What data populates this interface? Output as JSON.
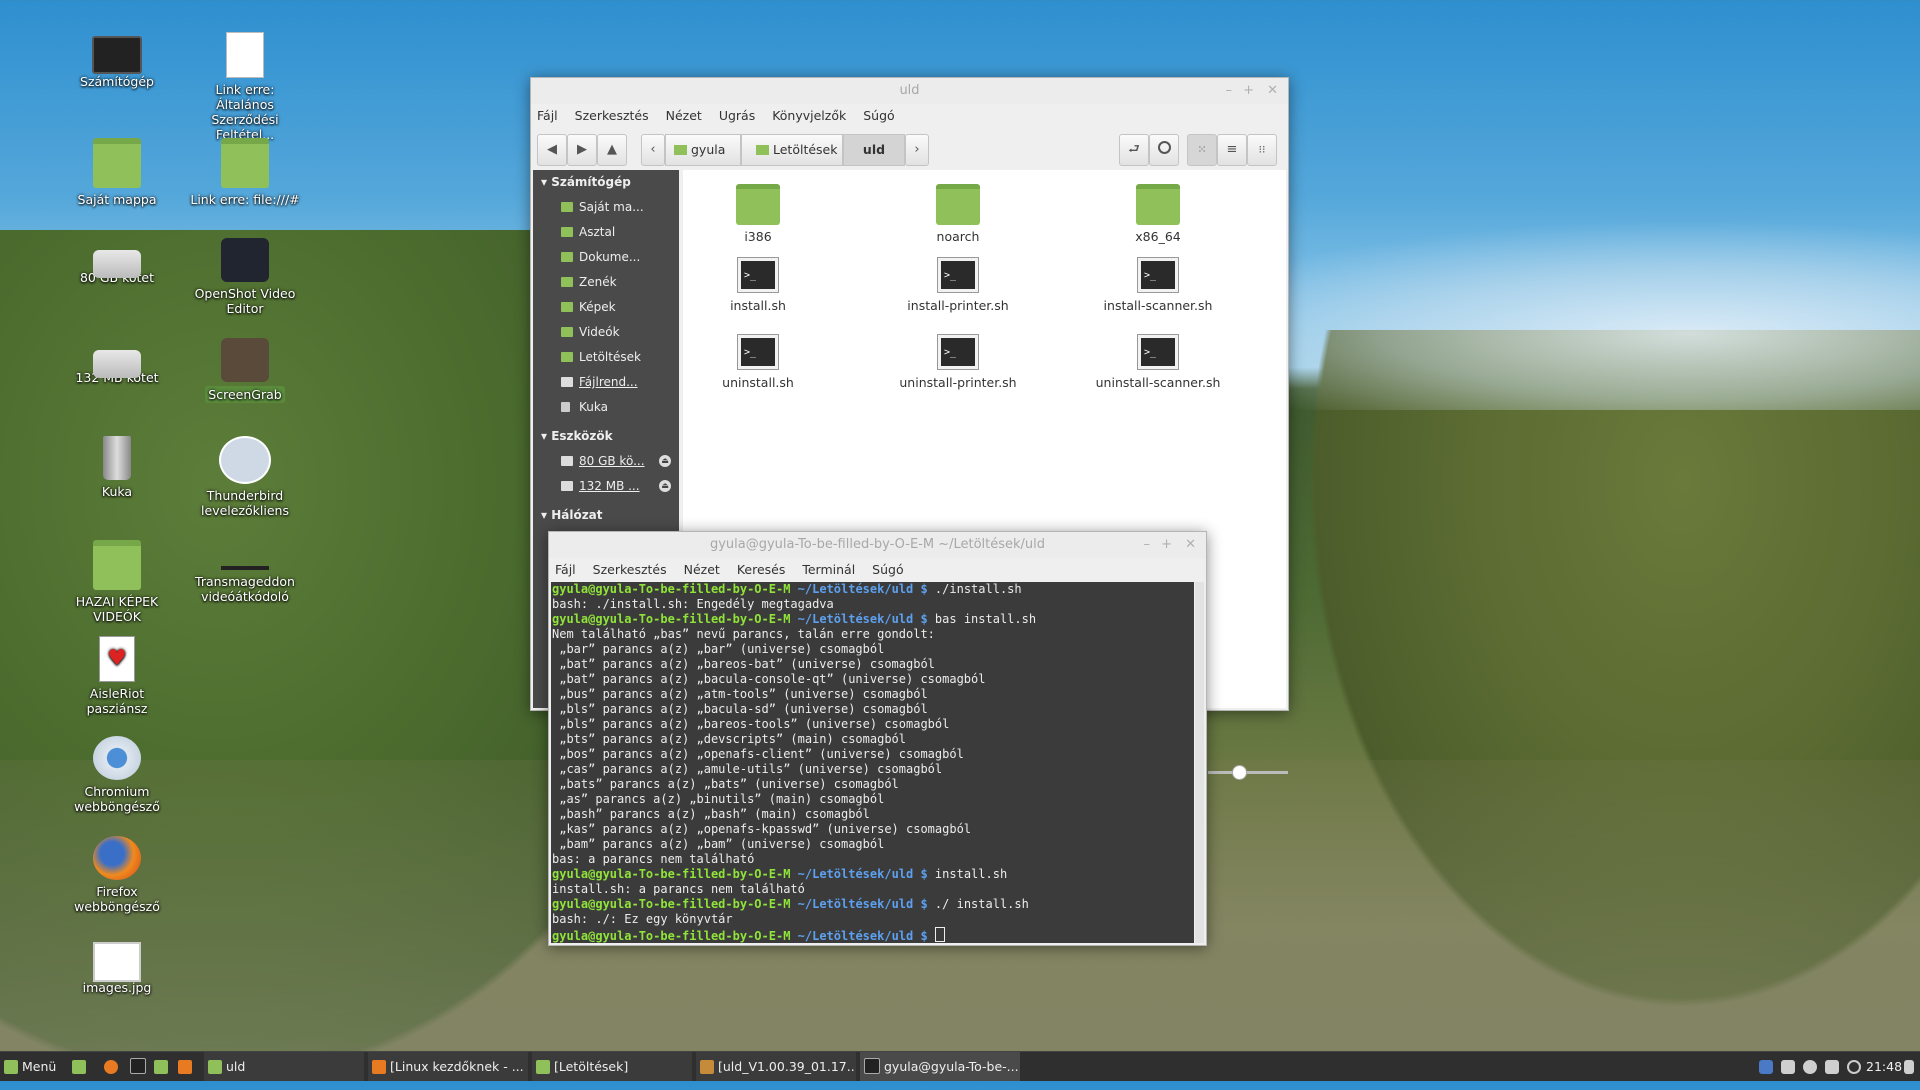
{
  "desktop": {
    "icons": [
      {
        "label": "Számítógép"
      },
      {
        "label": "Link erre: Általános Szerződési Feltétel..."
      },
      {
        "label": "Saját mappa"
      },
      {
        "label": "Link erre: file:///#"
      },
      {
        "label": "80 GB kötet"
      },
      {
        "label": "OpenShot Video Editor"
      },
      {
        "label": "132 MB kötet"
      },
      {
        "label": "ScreenGrab"
      },
      {
        "label": "Kuka"
      },
      {
        "label": "Thunderbird levelezőkliens"
      },
      {
        "label": "HAZAI KÉPEK VIDEÓK"
      },
      {
        "label": "Transmageddon videóátkódoló"
      },
      {
        "label": "AisleRiot pasziánsz"
      },
      {
        "label": "Chromium webböngésző"
      },
      {
        "label": "Firefox webböngésző"
      },
      {
        "label": "images.jpg"
      }
    ]
  },
  "file_manager": {
    "title": "uld",
    "window_controls": {
      "minimize": "–",
      "maximize": "+",
      "close": "✕"
    },
    "menu": [
      "Fájl",
      "Szerkesztés",
      "Nézet",
      "Ugrás",
      "Könyvjelzők",
      "Súgó"
    ],
    "toolbar": {
      "back": "◀",
      "forward": "▶",
      "up": "▲",
      "prev": "‹",
      "next": "›",
      "breadcrumbs": [
        "gyula",
        "Letöltések",
        "uld"
      ],
      "toggle_location": "⮐",
      "search": "⌕"
    },
    "sidebar": {
      "sections": [
        {
          "title": "Számítógép",
          "items": [
            "Saját ma...",
            "Asztal",
            "Dokume...",
            "Zenék",
            "Képek",
            "Videók",
            "Letöltések",
            "Fájlrend...",
            "Kuka"
          ]
        },
        {
          "title": "Eszközök",
          "items": [
            "80 GB kö...",
            "132 MB ..."
          ]
        },
        {
          "title": "Hálózat",
          "items": []
        }
      ]
    },
    "files": [
      {
        "name": "i386",
        "type": "folder"
      },
      {
        "name": "noarch",
        "type": "folder"
      },
      {
        "name": "x86_64",
        "type": "folder"
      },
      {
        "name": "install.sh",
        "type": "script"
      },
      {
        "name": "install-printer.sh",
        "type": "script"
      },
      {
        "name": "install-scanner.sh",
        "type": "script"
      },
      {
        "name": "uninstall.sh",
        "type": "script"
      },
      {
        "name": "uninstall-printer.sh",
        "type": "script"
      },
      {
        "name": "uninstall-scanner.sh",
        "type": "script"
      }
    ],
    "script_glyph": ">_"
  },
  "terminal": {
    "title": "gyula@gyula-To-be-filled-by-O-E-M ~/Letöltések/uld",
    "window_controls": {
      "minimize": "–",
      "maximize": "+",
      "close": "✕"
    },
    "menu": [
      "Fájl",
      "Szerkesztés",
      "Nézet",
      "Keresés",
      "Terminál",
      "Súgó"
    ],
    "prompt_user": "gyula@gyula-To-be-filled-by-O-E-M",
    "prompt_path": "~/Letöltések/uld $",
    "lines": [
      {
        "kind": "cmd",
        "text": " ./install.sh"
      },
      {
        "kind": "out",
        "text": "bash: ./install.sh: Engedély megtagadva"
      },
      {
        "kind": "cmd",
        "text": " bas install.sh"
      },
      {
        "kind": "out",
        "text": "Nem található „bas” nevű parancs, talán erre gondolt:"
      },
      {
        "kind": "out",
        "text": " „bar” parancs a(z) „bar” (universe) csomagból"
      },
      {
        "kind": "out",
        "text": " „bat” parancs a(z) „bareos-bat” (universe) csomagból"
      },
      {
        "kind": "out",
        "text": " „bat” parancs a(z) „bacula-console-qt” (universe) csomagból"
      },
      {
        "kind": "out",
        "text": " „bus” parancs a(z) „atm-tools” (universe) csomagból"
      },
      {
        "kind": "out",
        "text": " „bls” parancs a(z) „bacula-sd” (universe) csomagból"
      },
      {
        "kind": "out",
        "text": " „bls” parancs a(z) „bareos-tools” (universe) csomagból"
      },
      {
        "kind": "out",
        "text": " „bts” parancs a(z) „devscripts” (main) csomagból"
      },
      {
        "kind": "out",
        "text": " „bos” parancs a(z) „openafs-client” (universe) csomagból"
      },
      {
        "kind": "out",
        "text": " „cas” parancs a(z) „amule-utils” (universe) csomagból"
      },
      {
        "kind": "out",
        "text": " „bats” parancs a(z) „bats” (universe) csomagból"
      },
      {
        "kind": "out",
        "text": " „as” parancs a(z) „binutils” (main) csomagból"
      },
      {
        "kind": "out",
        "text": " „bash” parancs a(z) „bash” (main) csomagból"
      },
      {
        "kind": "out",
        "text": " „kas” parancs a(z) „openafs-kpasswd” (universe) csomagból"
      },
      {
        "kind": "out",
        "text": " „bam” parancs a(z) „bam” (universe) csomagból"
      },
      {
        "kind": "out",
        "text": "bas: a parancs nem található"
      },
      {
        "kind": "cmd",
        "text": " install.sh"
      },
      {
        "kind": "out",
        "text": "install.sh: a parancs nem található"
      },
      {
        "kind": "cmd",
        "text": " ./ install.sh"
      },
      {
        "kind": "out",
        "text": "bash: ./: Ez egy könyvtár"
      },
      {
        "kind": "cmd",
        "text": " "
      }
    ]
  },
  "taskbar": {
    "menu_label": "Menü",
    "tasks": [
      {
        "label": "uld"
      },
      {
        "label": "[Linux kezdőknek - ..."
      },
      {
        "label": "[Letöltések]"
      },
      {
        "label": "[uld_V1.00.39_01.17...."
      },
      {
        "label": "gyula@gyula-To-be-..."
      }
    ],
    "clock": "21:48"
  },
  "colors": {
    "prompt_green": "#8fe339",
    "prompt_blue": "#5da0ef",
    "terminal_bg": "#3b3b3b",
    "sidebar_bg": "#4a4a4a",
    "mint_green": "#8fc05a"
  }
}
